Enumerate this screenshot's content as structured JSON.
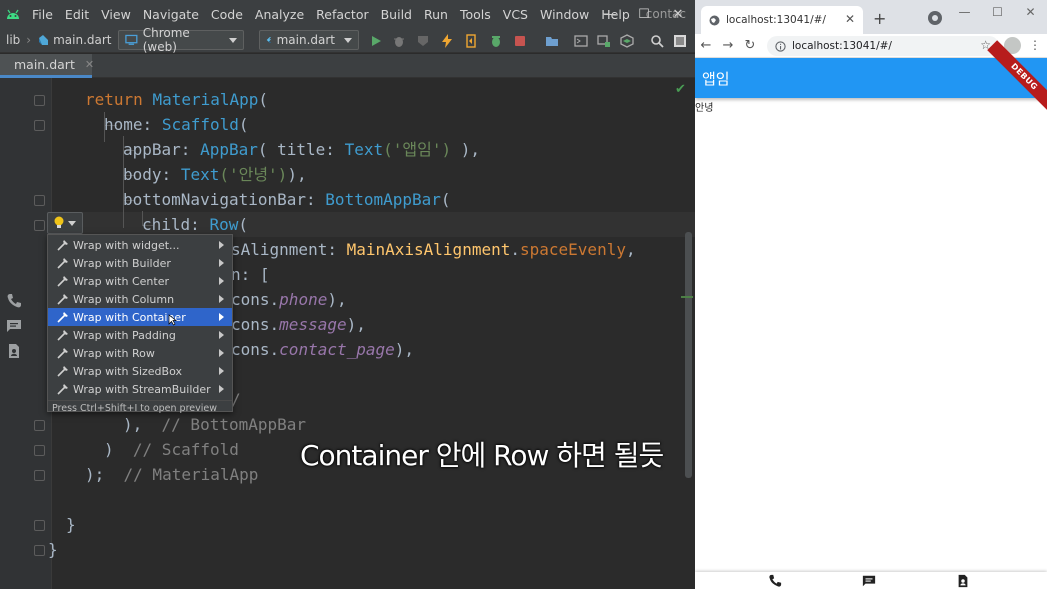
{
  "ide": {
    "menu": [
      "File",
      "Edit",
      "View",
      "Navigate",
      "Code",
      "Analyze",
      "Refactor",
      "Build",
      "Run",
      "Tools",
      "VCS",
      "Window",
      "Help"
    ],
    "window_title": "contact",
    "window_controls": [
      "—",
      "☐",
      "✕"
    ],
    "nav": {
      "crumb_lib": "lib",
      "crumb_file": "main.dart",
      "device_combo": "Chrome (web)",
      "run_config": "main.dart"
    },
    "tab": {
      "label": "main.dart",
      "close": "✕"
    },
    "status_check": "✔",
    "code": {
      "l1": {
        "kw": "return",
        "cls": "MaterialApp",
        "rest": "("
      },
      "l2": {
        "prop": "home:",
        "cls": "Scaffold",
        "rest": "("
      },
      "l3": {
        "prop": "appBar:",
        "cls1": "AppBar",
        "mid": "( title: ",
        "cls2": "Text",
        "str": "('앱임')",
        "rest": " ),"
      },
      "l4": {
        "prop": "body:",
        "cls": "Text",
        "str": "('안녕')",
        "rest": "),"
      },
      "l5": {
        "prop": "bottomNavigationBar:",
        "cls": "BottomAppBar",
        "rest": "("
      },
      "l6": {
        "prop": "child:",
        "cls": "Row",
        "rest": "("
      },
      "l7": {
        "pre": "sAlignment: ",
        "enumcls": "MainAxisAlignment",
        "dot": ".",
        "enumval": "spaceEvenly",
        "rest": ","
      },
      "l8": {
        "pre": "n: ["
      },
      "l9": {
        "pre": "cons.",
        "val": "phone",
        "rest": "),"
      },
      "l10": {
        "pre": "cons.",
        "val": "message",
        "rest": "),"
      },
      "l11": {
        "pre": "cons.",
        "val": "contact_page",
        "rest": "),"
      },
      "l12": {
        "cmt": "/"
      },
      "l13": {
        "pre": "),",
        "cmt": "// BottomAppBar"
      },
      "l14": {
        "pre": ")",
        "cmt": "// Scaffold"
      },
      "l15": {
        "pre": ");",
        "cmt": "// MaterialApp"
      },
      "l16": {
        "pre": "}"
      },
      "l17": {
        "pre": "}"
      }
    },
    "popup": {
      "items": [
        {
          "label": "Wrap with widget..."
        },
        {
          "label": "Wrap with Builder"
        },
        {
          "label": "Wrap with Center"
        },
        {
          "label": "Wrap with Column"
        },
        {
          "label": "Wrap with Container",
          "selected": true
        },
        {
          "label": "Wrap with Padding"
        },
        {
          "label": "Wrap with Row"
        },
        {
          "label": "Wrap with SizedBox"
        },
        {
          "label": "Wrap with StreamBuilder"
        }
      ],
      "hint": "Press Ctrl+Shift+I to open preview"
    },
    "subtitle": "Container 안에 Row 하면 될듯"
  },
  "browser": {
    "tab_title": "localhost:13041/#/",
    "tab_close": "✕",
    "new_tab": "+",
    "url": "localhost:13041/#/",
    "window_controls": [
      "—",
      "☐",
      "✕"
    ],
    "nav": {
      "back": "←",
      "forward": "→",
      "reload": "↻",
      "star": "☆",
      "menu": "⋮"
    },
    "app": {
      "title": "앱임",
      "body": "안녕",
      "debug_banner": "DEBUG",
      "bottom_icons": [
        "phone-icon",
        "message-icon",
        "contact-page-icon"
      ]
    }
  },
  "colors": {
    "appbar": "#2196f3",
    "selection": "#2f65ca",
    "ide_bg": "#2b2b2b"
  }
}
